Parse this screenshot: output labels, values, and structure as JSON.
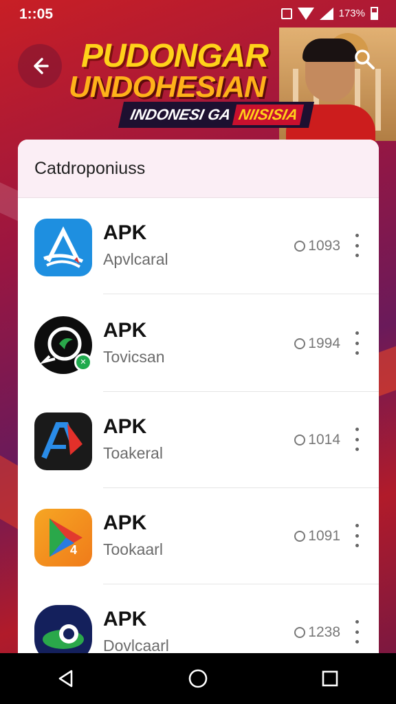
{
  "status": {
    "time": "1::05",
    "battery": "173%"
  },
  "banner": {
    "title_line1": "PUDONGAR",
    "title_line2": "UNDOHESIAN",
    "tag_white": "INDONESI GA",
    "tag_highlight": "NIISISIA"
  },
  "section_title": "Catdroponiuss",
  "apps": [
    {
      "title": "APK",
      "subtitle": "Apvlcaral",
      "count": "1093",
      "icon": "blue-triangle-app-icon"
    },
    {
      "title": "APK",
      "subtitle": "Tovicsan",
      "count": "1994",
      "icon": "black-circle-chat-app-icon"
    },
    {
      "title": "APK",
      "subtitle": "Toakeral",
      "count": "1014",
      "icon": "dark-red-blue-a-app-icon"
    },
    {
      "title": "APK",
      "subtitle": "Tookaarl",
      "count": "1091",
      "icon": "orange-play-app-icon"
    },
    {
      "title": "APK",
      "subtitle": "Dovlcaarl",
      "count": "1238",
      "icon": "navy-planet-app-icon"
    }
  ],
  "colors": {
    "accent_yellow": "#ffd21a",
    "brand_red": "#c8102e",
    "badge_green": "#1faa4d",
    "card_header": "#fbeef5"
  }
}
